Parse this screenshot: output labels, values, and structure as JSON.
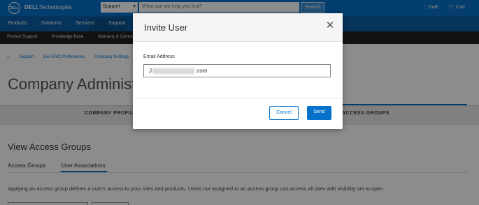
{
  "topbar": {
    "logo_text": "DELL",
    "brand_bold": "DELL",
    "brand_rest": "Technologies",
    "search_scope": "Support",
    "search_placeholder": "What can we help you find?",
    "search_button": "Search",
    "user_label": "Dale",
    "cart_label": "Cart"
  },
  "main_nav": {
    "items": [
      "Products",
      "Solutions",
      "Services",
      "Support"
    ]
  },
  "sub_nav": {
    "items": [
      "Product Support",
      "Knowledge Base",
      "Warranty & Contracts"
    ]
  },
  "breadcrumb": {
    "items": [
      "Support",
      "Dell EMC Preferences",
      "Company Settings"
    ]
  },
  "page": {
    "title": "Company Administration",
    "tabs": [
      "COMPANY PROFILE",
      "ACCESS GROUPS"
    ],
    "active_tab": "ACCESS GROUPS",
    "section_title": "View Access Groups",
    "sub_tabs": [
      "Access Groups",
      "User Associations"
    ],
    "active_sub_tab": "User Associations",
    "help_text": "Applying an access group defines a user's access to your sites and products. Users not assigned to an access group can access all sites with visibility set to open."
  },
  "modal": {
    "title": "Invite User",
    "field_label": "Email Address",
    "email_prefix": "J",
    "email_suffix": ".com",
    "cancel_label": "Cancel",
    "send_label": "Send"
  },
  "colors": {
    "brand_blue": "#0672cb",
    "nav_dark": "#0b5ea6",
    "subnav": "#222222"
  }
}
